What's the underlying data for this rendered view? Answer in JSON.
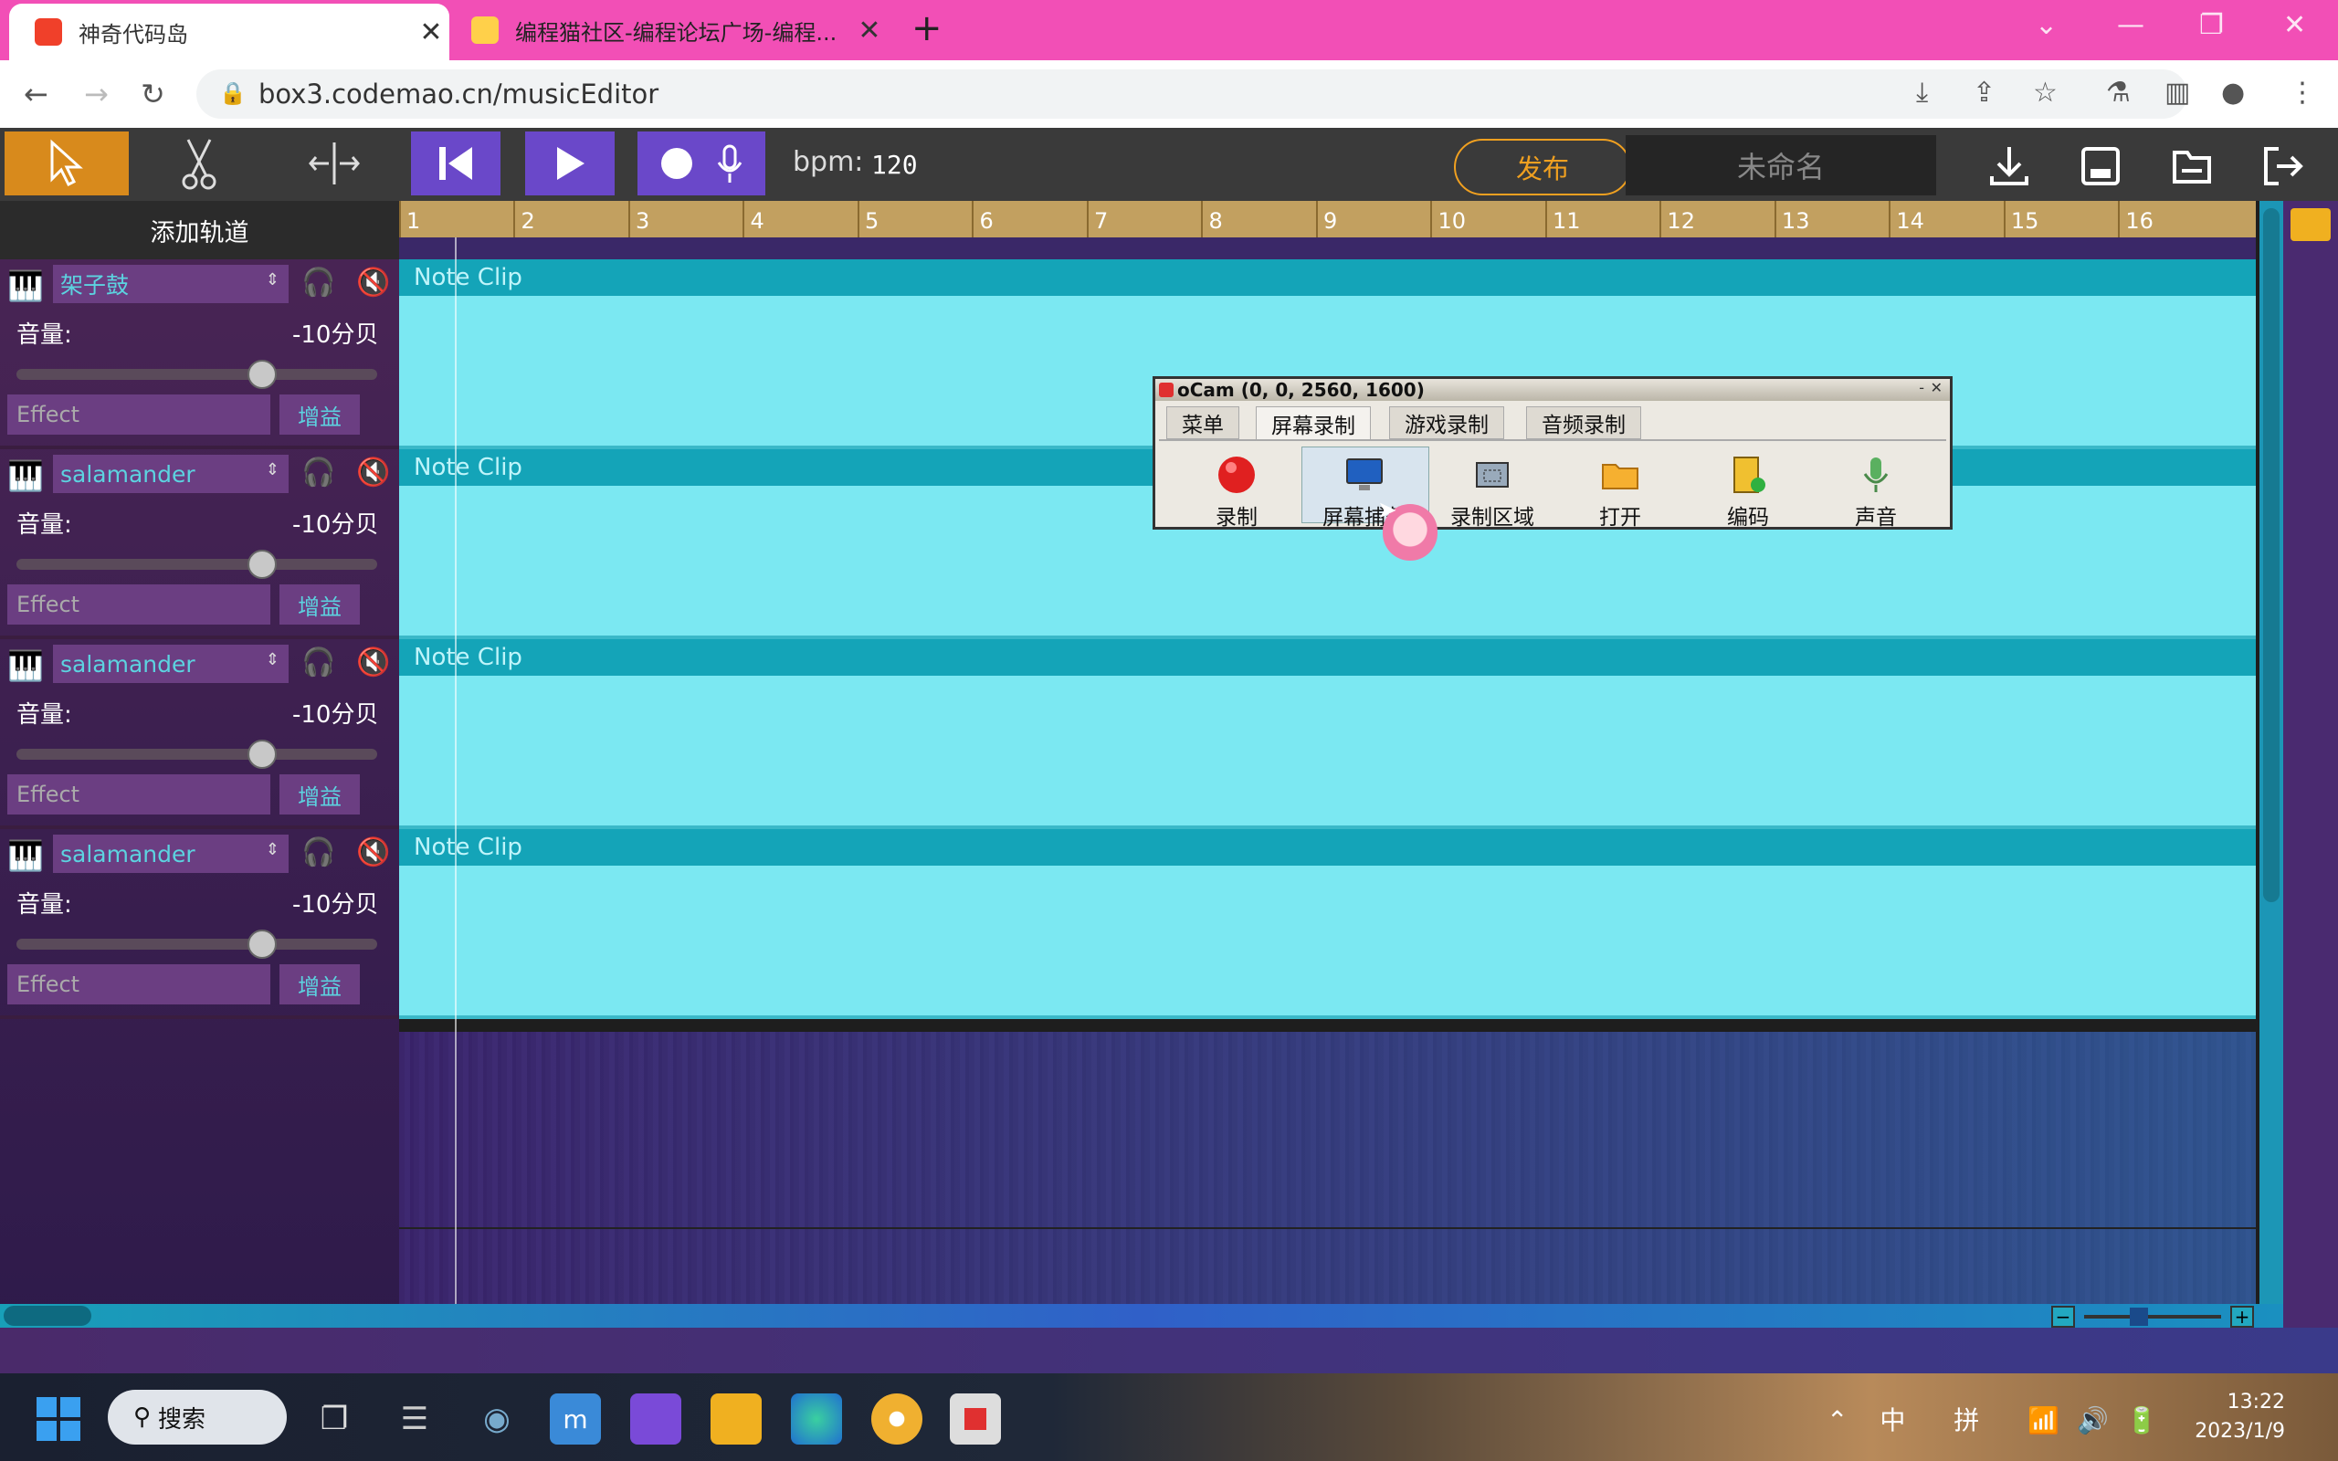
{
  "browser": {
    "tabs": [
      {
        "title": "神奇代码岛",
        "active": true
      },
      {
        "title": "编程猫社区-编程论坛广场-编程...",
        "active": false
      }
    ],
    "url": "box3.codemao.cn/musicEditor"
  },
  "toolbar": {
    "bpm_label": "bpm:",
    "bpm_value": "120",
    "publish_label": "发布",
    "project_name": "未命名"
  },
  "tracks_panel": {
    "add_track_label": "添加轨道",
    "tracks": [
      {
        "instrument": "架子鼓",
        "volume_label": "音量:",
        "volume_value": "-10分贝",
        "volume_fraction": 0.68,
        "effect_placeholder": "Effect",
        "gain_label": "增益"
      },
      {
        "instrument": "salamander",
        "volume_label": "音量:",
        "volume_value": "-10分贝",
        "volume_fraction": 0.68,
        "effect_placeholder": "Effect",
        "gain_label": "增益"
      },
      {
        "instrument": "salamander",
        "volume_label": "音量:",
        "volume_value": "-10分贝",
        "volume_fraction": 0.68,
        "effect_placeholder": "Effect",
        "gain_label": "增益"
      },
      {
        "instrument": "salamander",
        "volume_label": "音量:",
        "volume_value": "-10分贝",
        "volume_fraction": 0.68,
        "effect_placeholder": "Effect",
        "gain_label": "增益"
      }
    ]
  },
  "timeline": {
    "bars": [
      "1",
      "2",
      "3",
      "4",
      "5",
      "6",
      "7",
      "8",
      "9",
      "10",
      "11",
      "12",
      "13",
      "14",
      "15",
      "16"
    ],
    "clips": [
      "Note Clip",
      "Note Clip",
      "Note Clip",
      "Note Clip"
    ]
  },
  "ocam": {
    "title": "oCam (0, 0, 2560, 1600)",
    "tabs": [
      "菜单",
      "屏幕录制",
      "游戏录制",
      "音频录制"
    ],
    "selected_tab": "屏幕录制",
    "buttons": [
      "录制",
      "屏幕捕获",
      "录制区域",
      "打开",
      "编码",
      "声音"
    ]
  },
  "taskbar": {
    "search_label": "搜索",
    "tray_ime1": "中",
    "tray_ime2": "拼",
    "time": "13:22",
    "date": "2023/1/9"
  }
}
